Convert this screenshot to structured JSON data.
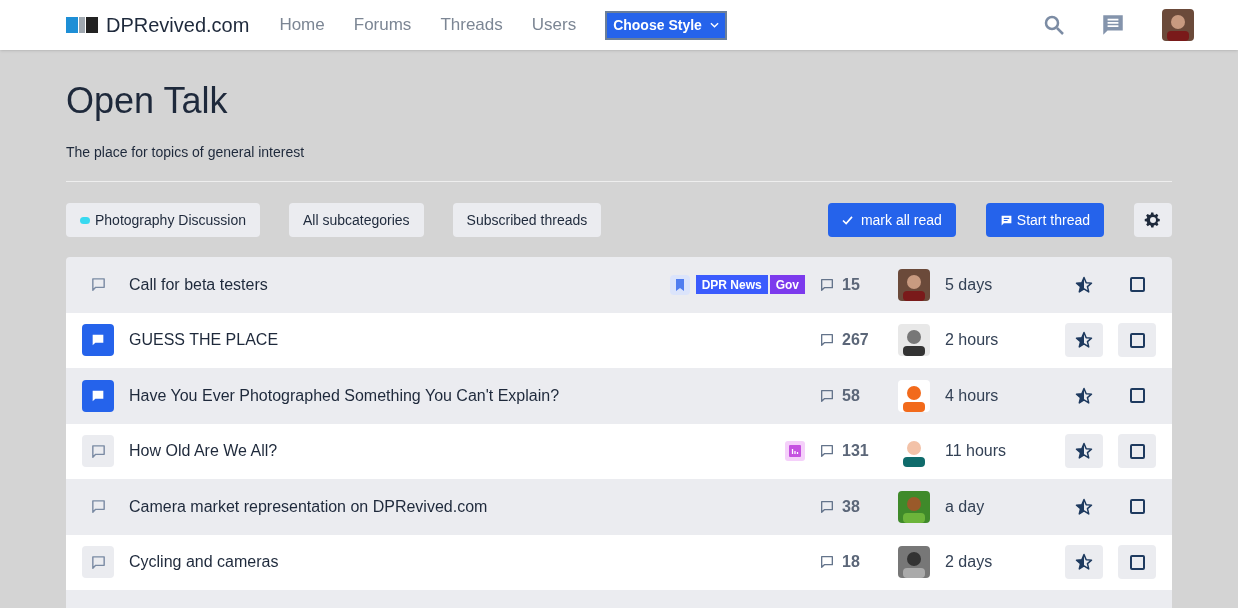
{
  "header": {
    "site_name": "DPRevived.com",
    "nav": [
      {
        "label": "Home"
      },
      {
        "label": "Forums"
      },
      {
        "label": "Threads"
      },
      {
        "label": "Users"
      }
    ],
    "style_button": "Choose Style"
  },
  "category": {
    "title": "Open Talk",
    "description": "The place for topics of general interest"
  },
  "filters": [
    {
      "label": "Photography Discussion",
      "color": "#38d9f0"
    },
    {
      "label": "All subcategories"
    },
    {
      "label": "Subscribed threads"
    }
  ],
  "actions": {
    "mark_read": "mark all read",
    "start_thread": "Start thread"
  },
  "threads": [
    {
      "title": "Call for beta testers",
      "unread": false,
      "bookmarked": true,
      "poll": false,
      "tags": [
        {
          "label": "DPR News",
          "color": "#3b5bfd"
        },
        {
          "label": "Gov",
          "color": "#7c3aed"
        }
      ],
      "replies": "15",
      "time": "5 days",
      "checked": false
    },
    {
      "title": "GUESS THE PLACE",
      "unread": true,
      "bookmarked": false,
      "poll": false,
      "replies": "267",
      "time": "2 hours",
      "checked": false
    },
    {
      "title": "Have You Ever Photographed Something You Can't Explain?",
      "unread": true,
      "bookmarked": false,
      "poll": false,
      "replies": "58",
      "time": "4 hours",
      "checked": false
    },
    {
      "title": "How Old Are We All?",
      "unread": false,
      "bookmarked": false,
      "poll": true,
      "replies": "131",
      "time": "11 hours",
      "checked": false
    },
    {
      "title": "Camera market representation on DPRevived.com",
      "unread": false,
      "bookmarked": false,
      "poll": false,
      "replies": "38",
      "time": "a day",
      "checked": false
    },
    {
      "title": "Cycling and cameras",
      "unread": false,
      "bookmarked": false,
      "poll": false,
      "replies": "18",
      "time": "2 days",
      "checked": false
    }
  ]
}
